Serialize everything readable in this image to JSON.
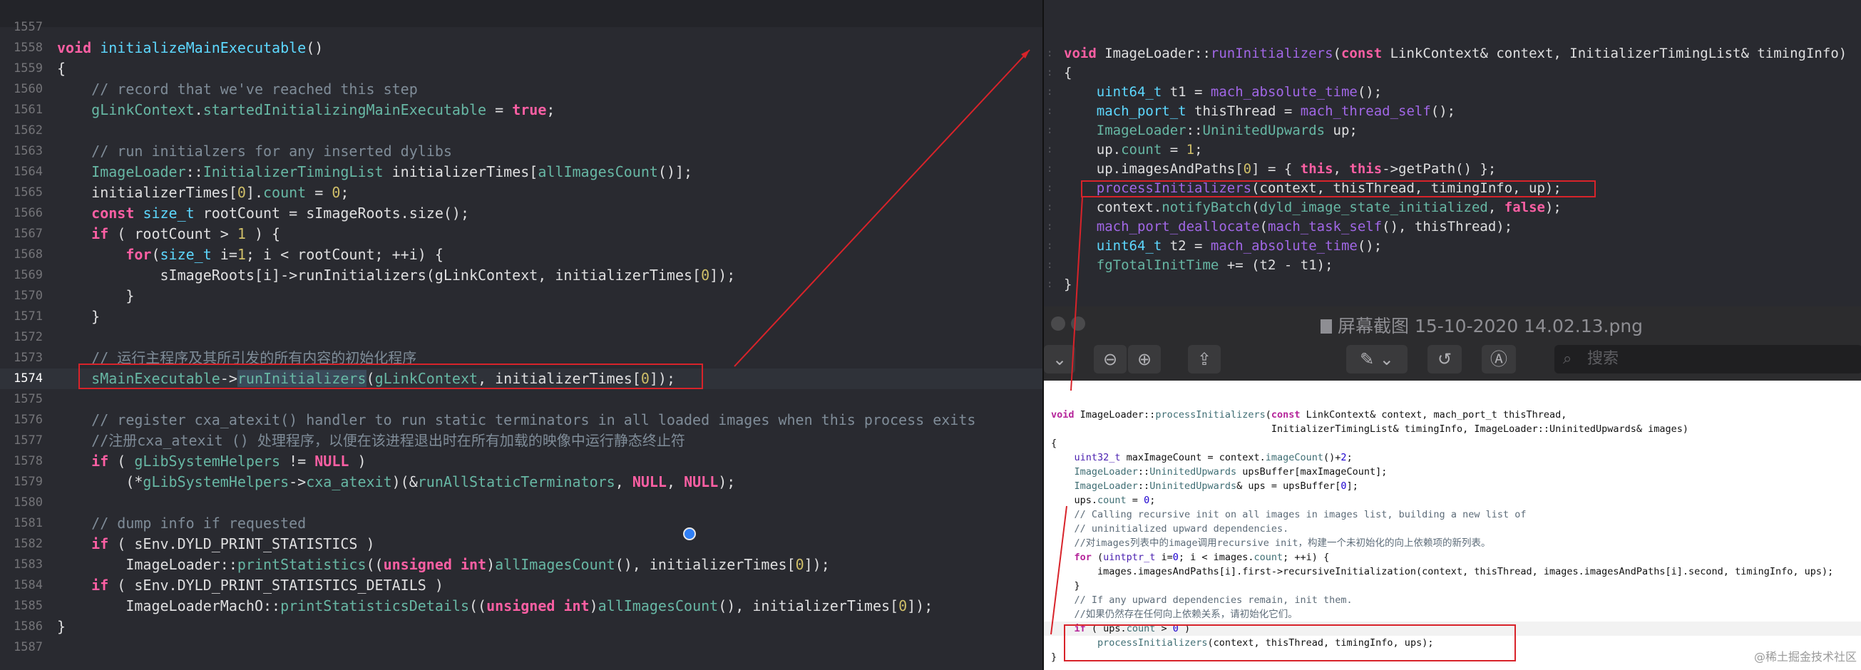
{
  "left_editor": {
    "lines": [
      {
        "num": "1557",
        "tokens": []
      },
      {
        "num": "1558",
        "tokens": [
          {
            "t": "void",
            "c": "kw"
          },
          {
            "t": " "
          },
          {
            "t": "initializeMainExecutable",
            "c": "ty"
          },
          {
            "t": "()"
          }
        ]
      },
      {
        "num": "1559",
        "tokens": [
          {
            "t": "{"
          }
        ]
      },
      {
        "num": "1560",
        "tokens": [
          {
            "t": "    "
          },
          {
            "t": "// record that we've reached this step",
            "c": "cm"
          }
        ]
      },
      {
        "num": "1561",
        "tokens": [
          {
            "t": "    "
          },
          {
            "t": "gLinkContext",
            "c": "fn"
          },
          {
            "t": "."
          },
          {
            "t": "startedInitializingMainExecutable",
            "c": "fn"
          },
          {
            "t": " = "
          },
          {
            "t": "true",
            "c": "kw"
          },
          {
            "t": ";"
          }
        ]
      },
      {
        "num": "1562",
        "tokens": []
      },
      {
        "num": "1563",
        "tokens": [
          {
            "t": "    "
          },
          {
            "t": "// run initialzers for any inserted dylibs",
            "c": "cm"
          }
        ]
      },
      {
        "num": "1564",
        "tokens": [
          {
            "t": "    "
          },
          {
            "t": "ImageLoader",
            "c": "fn"
          },
          {
            "t": "::"
          },
          {
            "t": "InitializerTimingList",
            "c": "fn"
          },
          {
            "t": " initializerTimes["
          },
          {
            "t": "allImagesCount",
            "c": "fn"
          },
          {
            "t": "()];"
          }
        ]
      },
      {
        "num": "1565",
        "tokens": [
          {
            "t": "    initializerTimes["
          },
          {
            "t": "0",
            "c": "nu"
          },
          {
            "t": "]."
          },
          {
            "t": "count",
            "c": "fn"
          },
          {
            "t": " = "
          },
          {
            "t": "0",
            "c": "nu"
          },
          {
            "t": ";"
          }
        ]
      },
      {
        "num": "1566",
        "tokens": [
          {
            "t": "    "
          },
          {
            "t": "const",
            "c": "kw"
          },
          {
            "t": " "
          },
          {
            "t": "size_t",
            "c": "ty"
          },
          {
            "t": " rootCount = sImageRoots.size();"
          }
        ]
      },
      {
        "num": "1567",
        "tokens": [
          {
            "t": "    "
          },
          {
            "t": "if",
            "c": "kw"
          },
          {
            "t": " ( rootCount > "
          },
          {
            "t": "1",
            "c": "nu"
          },
          {
            "t": " ) {"
          }
        ]
      },
      {
        "num": "1568",
        "tokens": [
          {
            "t": "        "
          },
          {
            "t": "for",
            "c": "kw"
          },
          {
            "t": "("
          },
          {
            "t": "size_t",
            "c": "ty"
          },
          {
            "t": " i="
          },
          {
            "t": "1",
            "c": "nu"
          },
          {
            "t": "; i < rootCount; ++i) {"
          }
        ]
      },
      {
        "num": "1569",
        "tokens": [
          {
            "t": "            sImageRoots[i]->runInitializers(gLinkContext, initializerTimes["
          },
          {
            "t": "0",
            "c": "nu"
          },
          {
            "t": "]);"
          }
        ]
      },
      {
        "num": "1570",
        "tokens": [
          {
            "t": "        }"
          }
        ]
      },
      {
        "num": "1571",
        "tokens": [
          {
            "t": "    }"
          }
        ]
      },
      {
        "num": "1572",
        "tokens": []
      },
      {
        "num": "1573",
        "tokens": [
          {
            "t": "    "
          },
          {
            "t": "// 运行主程序及其所引发的所有内容的初始化程序",
            "c": "cm"
          }
        ]
      },
      {
        "num": "1574",
        "tokens": [
          {
            "t": "    "
          },
          {
            "t": "sMainExecutable",
            "c": "fn"
          },
          {
            "t": "->"
          },
          {
            "t": "runInitializers",
            "c": "fn hl"
          },
          {
            "t": "("
          },
          {
            "t": "gLinkContext",
            "c": "fn"
          },
          {
            "t": ", initializerTimes["
          },
          {
            "t": "0",
            "c": "nu"
          },
          {
            "t": "]);"
          }
        ]
      },
      {
        "num": "1575",
        "tokens": []
      },
      {
        "num": "1576",
        "tokens": [
          {
            "t": "    "
          },
          {
            "t": "// register cxa_atexit() handler to run static terminators in all loaded images when this process exits",
            "c": "cm"
          }
        ]
      },
      {
        "num": "1577",
        "tokens": [
          {
            "t": "    "
          },
          {
            "t": "//注册cxa_atexit () 处理程序，以便在该进程退出时在所有加载的映像中运行静态终止符",
            "c": "cm"
          }
        ]
      },
      {
        "num": "1578",
        "tokens": [
          {
            "t": "    "
          },
          {
            "t": "if",
            "c": "kw"
          },
          {
            "t": " ( "
          },
          {
            "t": "gLibSystemHelpers",
            "c": "fn"
          },
          {
            "t": " != "
          },
          {
            "t": "NULL",
            "c": "kw"
          },
          {
            "t": " )"
          }
        ]
      },
      {
        "num": "1579",
        "tokens": [
          {
            "t": "        (*"
          },
          {
            "t": "gLibSystemHelpers",
            "c": "fn"
          },
          {
            "t": "->"
          },
          {
            "t": "cxa_atexit",
            "c": "fn"
          },
          {
            "t": ")(&"
          },
          {
            "t": "runAllStaticTerminators",
            "c": "fn"
          },
          {
            "t": ", "
          },
          {
            "t": "NULL",
            "c": "kw"
          },
          {
            "t": ", "
          },
          {
            "t": "NULL",
            "c": "kw"
          },
          {
            "t": ");"
          }
        ]
      },
      {
        "num": "1580",
        "tokens": []
      },
      {
        "num": "1581",
        "tokens": [
          {
            "t": "    "
          },
          {
            "t": "// dump info if requested",
            "c": "cm"
          }
        ]
      },
      {
        "num": "1582",
        "tokens": [
          {
            "t": "    "
          },
          {
            "t": "if",
            "c": "kw"
          },
          {
            "t": " ( sEnv.DYLD_PRINT_STATISTICS )"
          }
        ]
      },
      {
        "num": "1583",
        "tokens": [
          {
            "t": "        ImageLoader::"
          },
          {
            "t": "printStatistics",
            "c": "fn"
          },
          {
            "t": "(("
          },
          {
            "t": "unsigned",
            "c": "kw"
          },
          {
            "t": " "
          },
          {
            "t": "int",
            "c": "kw"
          },
          {
            "t": ")"
          },
          {
            "t": "allImagesCount",
            "c": "fn"
          },
          {
            "t": "(), initializerTimes["
          },
          {
            "t": "0",
            "c": "nu"
          },
          {
            "t": "]);"
          }
        ]
      },
      {
        "num": "1584",
        "tokens": [
          {
            "t": "    "
          },
          {
            "t": "if",
            "c": "kw"
          },
          {
            "t": " ( sEnv.DYLD_PRINT_STATISTICS_DETAILS )"
          }
        ]
      },
      {
        "num": "1585",
        "tokens": [
          {
            "t": "        ImageLoaderMachO::"
          },
          {
            "t": "printStatisticsDetails",
            "c": "fn"
          },
          {
            "t": "(("
          },
          {
            "t": "unsigned",
            "c": "kw"
          },
          {
            "t": " "
          },
          {
            "t": "int",
            "c": "kw"
          },
          {
            "t": ")"
          },
          {
            "t": "allImagesCount",
            "c": "fn"
          },
          {
            "t": "(), initializerTimes["
          },
          {
            "t": "0",
            "c": "nu"
          },
          {
            "t": "]);"
          }
        ]
      },
      {
        "num": "1586",
        "tokens": [
          {
            "t": "}"
          }
        ]
      },
      {
        "num": "1587",
        "tokens": []
      }
    ]
  },
  "right_top_editor": {
    "lines": [
      {
        "tokens": [
          {
            "t": "void",
            "c": "kw"
          },
          {
            "t": " ImageLoader::"
          },
          {
            "t": "runInitializers",
            "c": "pk"
          },
          {
            "t": "("
          },
          {
            "t": "const",
            "c": "kw"
          },
          {
            "t": " LinkContext& context, InitializerTimingList& timingInfo)"
          }
        ]
      },
      {
        "tokens": [
          {
            "t": "{"
          }
        ]
      },
      {
        "tokens": [
          {
            "t": "    "
          },
          {
            "t": "uint64_t",
            "c": "ty"
          },
          {
            "t": " t1 = "
          },
          {
            "t": "mach_absolute_time",
            "c": "pk"
          },
          {
            "t": "();"
          }
        ]
      },
      {
        "tokens": [
          {
            "t": "    "
          },
          {
            "t": "mach_port_t",
            "c": "ty"
          },
          {
            "t": " thisThread = "
          },
          {
            "t": "mach_thread_self",
            "c": "pk"
          },
          {
            "t": "();"
          }
        ]
      },
      {
        "tokens": [
          {
            "t": "    "
          },
          {
            "t": "ImageLoader",
            "c": "fn"
          },
          {
            "t": "::"
          },
          {
            "t": "UninitedUpwards",
            "c": "fn"
          },
          {
            "t": " up;"
          }
        ]
      },
      {
        "tokens": [
          {
            "t": "    up."
          },
          {
            "t": "count",
            "c": "fn"
          },
          {
            "t": " = "
          },
          {
            "t": "1",
            "c": "nu"
          },
          {
            "t": ";"
          }
        ]
      },
      {
        "tokens": [
          {
            "t": "    up.imagesAndPaths["
          },
          {
            "t": "0",
            "c": "nu"
          },
          {
            "t": "] = { "
          },
          {
            "t": "this",
            "c": "kw"
          },
          {
            "t": ", "
          },
          {
            "t": "this",
            "c": "kw"
          },
          {
            "t": "->getPath() };"
          }
        ]
      },
      {
        "tokens": [
          {
            "t": "    "
          },
          {
            "t": "processInitializers",
            "c": "pk"
          },
          {
            "t": "(context, thisThread, timingInfo, up);"
          }
        ]
      },
      {
        "tokens": [
          {
            "t": "    context."
          },
          {
            "t": "notifyBatch",
            "c": "fn"
          },
          {
            "t": "("
          },
          {
            "t": "dyld_image_state_initialized",
            "c": "fn"
          },
          {
            "t": ", "
          },
          {
            "t": "false",
            "c": "kw"
          },
          {
            "t": ");"
          }
        ]
      },
      {
        "tokens": [
          {
            "t": "    "
          },
          {
            "t": "mach_port_deallocate",
            "c": "pk"
          },
          {
            "t": "("
          },
          {
            "t": "mach_task_self",
            "c": "pk"
          },
          {
            "t": "(), thisThread);"
          }
        ]
      },
      {
        "tokens": [
          {
            "t": "    "
          },
          {
            "t": "uint64_t",
            "c": "ty"
          },
          {
            "t": " t2 = "
          },
          {
            "t": "mach_absolute_time",
            "c": "pk"
          },
          {
            "t": "();"
          }
        ]
      },
      {
        "tokens": [
          {
            "t": "    "
          },
          {
            "t": "fgTotalInitTime",
            "c": "fn"
          },
          {
            "t": " += (t2 - t1);"
          }
        ]
      },
      {
        "tokens": [
          {
            "t": "}"
          }
        ]
      }
    ]
  },
  "preview": {
    "title": "屏幕截图 15-10-2020 14.02.13.png",
    "search_placeholder": "搜索",
    "toolbar_icons": [
      "sidebar-toggle-icon",
      "zoom-out-icon",
      "zoom-in-icon",
      "share-icon",
      "markup-pen-icon",
      "rotate-icon",
      "annotate-icon",
      "search-icon"
    ]
  },
  "document": {
    "lines": [
      {
        "tokens": [
          {
            "t": "void",
            "c": "dk"
          },
          {
            "t": " ImageLoader::"
          },
          {
            "t": "processInitializers",
            "c": "df"
          },
          {
            "t": "("
          },
          {
            "t": "const",
            "c": "dk"
          },
          {
            "t": " LinkContext& context, mach_port_t thisThread,"
          }
        ]
      },
      {
        "tokens": [
          {
            "t": "                                      InitializerTimingList& timingInfo, ImageLoader::UninitedUpwards& images)"
          }
        ]
      },
      {
        "tokens": [
          {
            "t": "{"
          }
        ]
      },
      {
        "tokens": [
          {
            "t": "    "
          },
          {
            "t": "uint32_t",
            "c": "dt"
          },
          {
            "t": " maxImageCount = context."
          },
          {
            "t": "imageCount",
            "c": "df"
          },
          {
            "t": "()+"
          },
          {
            "t": "2",
            "c": "dn"
          },
          {
            "t": ";"
          }
        ]
      },
      {
        "tokens": [
          {
            "t": "    "
          },
          {
            "t": "ImageLoader",
            "c": "df"
          },
          {
            "t": "::"
          },
          {
            "t": "UninitedUpwards",
            "c": "df"
          },
          {
            "t": " upsBuffer[maxImageCount];"
          }
        ]
      },
      {
        "tokens": [
          {
            "t": "    "
          },
          {
            "t": "ImageLoader",
            "c": "df"
          },
          {
            "t": "::"
          },
          {
            "t": "UninitedUpwards",
            "c": "df"
          },
          {
            "t": "& ups = upsBuffer["
          },
          {
            "t": "0",
            "c": "dn"
          },
          {
            "t": "];"
          }
        ]
      },
      {
        "tokens": [
          {
            "t": "    ups."
          },
          {
            "t": "count",
            "c": "df"
          },
          {
            "t": " = "
          },
          {
            "t": "0",
            "c": "dn"
          },
          {
            "t": ";"
          }
        ]
      },
      {
        "tokens": [
          {
            "t": "    "
          },
          {
            "t": "// Calling recursive init on all images in images list, building a new list of",
            "c": "dc"
          }
        ]
      },
      {
        "tokens": [
          {
            "t": "    "
          },
          {
            "t": "// uninitialized upward dependencies.",
            "c": "dc"
          }
        ]
      },
      {
        "tokens": [
          {
            "t": "    "
          },
          {
            "t": "//对images列表中的image调用recursive init，构建一个未初始化的向上依赖项的新列表。",
            "c": "dc"
          }
        ]
      },
      {
        "tokens": [
          {
            "t": "    "
          },
          {
            "t": "for",
            "c": "dk"
          },
          {
            "t": " ("
          },
          {
            "t": "uintptr_t",
            "c": "dt"
          },
          {
            "t": " i="
          },
          {
            "t": "0",
            "c": "dn"
          },
          {
            "t": "; i < images."
          },
          {
            "t": "count",
            "c": "df"
          },
          {
            "t": "; ++i) {"
          }
        ]
      },
      {
        "tokens": [
          {
            "t": "        images.imagesAndPaths[i].first->recursiveInitialization(context, thisThread, images.imagesAndPaths[i].second, timingInfo, ups);"
          }
        ]
      },
      {
        "tokens": [
          {
            "t": "    }"
          }
        ]
      },
      {
        "tokens": [
          {
            "t": "    "
          },
          {
            "t": "// If any upward dependencies remain, init them.",
            "c": "dc"
          }
        ]
      },
      {
        "tokens": [
          {
            "t": "    "
          },
          {
            "t": "//如果仍然存在任何向上依赖关系，请初始化它们。",
            "c": "dc"
          }
        ]
      },
      {
        "tokens": [
          {
            "t": "    "
          },
          {
            "t": "if",
            "c": "dk"
          },
          {
            "t": " ( ups."
          },
          {
            "t": "count",
            "c": "df"
          },
          {
            "t": " > "
          },
          {
            "t": "0",
            "c": "dn"
          },
          {
            "t": " )"
          }
        ]
      },
      {
        "tokens": [
          {
            "t": "        "
          },
          {
            "t": "processInitializers",
            "c": "df"
          },
          {
            "t": "(context, thisThread, timingInfo, ups);"
          }
        ]
      },
      {
        "tokens": [
          {
            "t": "}"
          }
        ]
      }
    ],
    "watermark": "@稀土掘金技术社区"
  },
  "colors": {
    "editor_bg": "#292a30",
    "annotation_red": "#d8232a",
    "cursor_blue": "#2f7ff5"
  }
}
